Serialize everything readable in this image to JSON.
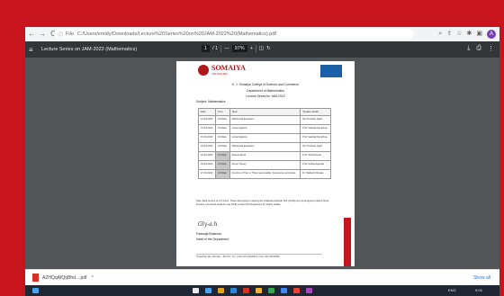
{
  "browser": {
    "back": "←",
    "forward": "→",
    "reload": "C",
    "info_icon": "ⓘ",
    "url_prefix": "File",
    "url": "C:/Users/emidy/Downloads/Lecture%20Series%20on%20JAM-2022%20(Mathematics).pdf",
    "icons": [
      "search-icon",
      "share-icon",
      "star-icon",
      "extensions-icon",
      "sidebar-icon"
    ],
    "profile_initial": "A"
  },
  "pdf_toolbar": {
    "menu": "≡",
    "title": "Lecture Series on JAM-2022 (Mathematics)",
    "page_current": "1",
    "page_total": "/ 1",
    "zoom_out": "—",
    "zoom": "97%",
    "zoom_in": "+",
    "download": "⤓",
    "print": "⎙",
    "more": "⋮"
  },
  "document": {
    "logo_text": "SOMAIYA",
    "logo_sub": "VIDYAVIHAR",
    "college": "K. J. Somaiya College of Science and Commerce",
    "department": "Department of Mathematics",
    "series": "Lecture Series for JAM-2022",
    "subject": "Subject: Mathematics",
    "table": {
      "headers": [
        "Date",
        "Time",
        "Topic",
        "Speaker details"
      ],
      "rows": [
        [
          "12-03-2022",
          "10:00am",
          "Differential Equations",
          "Mr. Prashant Jagtri"
        ],
        [
          "13-03-2022",
          "10:00am",
          "Linear Algebra",
          "Prof. Vaishali Kambhoje"
        ],
        [
          "15-03-2022",
          "10:00am",
          "Linear Algebra",
          "Prof. Vaishali Kambhoje"
        ],
        [
          "19-03-2022",
          "10:00am",
          "Differential Equations",
          "Mr. Prashant Jagtri"
        ],
        [
          "20-03-2022",
          "10:00am",
          "Real Analysis",
          "Prof. Shrikrishnah"
        ],
        [
          "26-03-2022",
          "10:00am",
          "Group Theory",
          "Prof. Sudha Agarwal"
        ],
        [
          "27-03-2022",
          "10:00am",
          "Function of Two or Three real variable, Sequences and series",
          "Dr. Mahesh Kolwale"
        ]
      ]
    },
    "note": "Note: Each lecture is of 2 hours. Those attempting or aspiring for Graduate Aptitude Test (GATE) are encouraged to attend these lectures. Interested students may kindly contact the Department for further details.",
    "signature": "Gly-a.h",
    "signatory_name": "Padmaja Bhalerao",
    "signatory_title": "Head of the Department",
    "footer": "Vidyavihar (E), Mumbai - 400 077. Tel: (+91) 022-21020101 | Fax: 022 25019040"
  },
  "downloads": {
    "filename": "AZHQqAfQqBhd....pdf",
    "chevron": "^",
    "show_all": "Show all"
  },
  "taskbar": {
    "lang": "ENG",
    "time": "9:04"
  },
  "colors": {
    "frame": "#c8141c",
    "pdf_toolbar": "#323639",
    "viewer_bg": "#525659",
    "brand": "#b01818"
  }
}
